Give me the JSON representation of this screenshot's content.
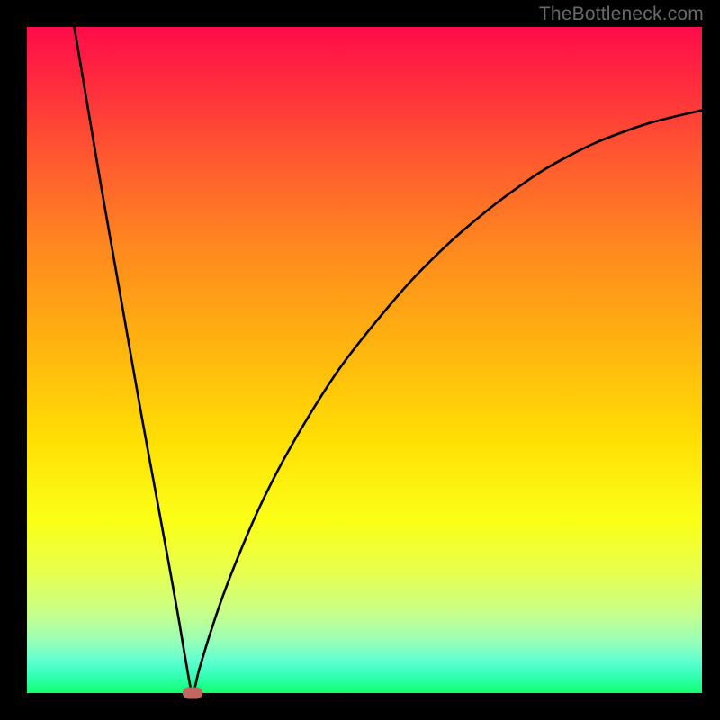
{
  "watermark": "TheBottleneck.com",
  "colors": {
    "frame": "#000000",
    "curve": "#000000",
    "marker": "#c06762"
  },
  "chart_data": {
    "type": "line",
    "title": "",
    "xlabel": "",
    "ylabel": "",
    "xlim": [
      0,
      100
    ],
    "ylim": [
      0,
      100
    ],
    "marker": {
      "x": 24.5,
      "y": 0
    },
    "curve_points": [
      {
        "x": 7.0,
        "y": 100.0
      },
      {
        "x": 9.0,
        "y": 88.0
      },
      {
        "x": 11.0,
        "y": 76.0
      },
      {
        "x": 13.0,
        "y": 64.5
      },
      {
        "x": 15.0,
        "y": 53.0
      },
      {
        "x": 17.0,
        "y": 41.5
      },
      {
        "x": 19.0,
        "y": 30.5
      },
      {
        "x": 21.0,
        "y": 19.5
      },
      {
        "x": 22.5,
        "y": 11.0
      },
      {
        "x": 23.5,
        "y": 5.0
      },
      {
        "x": 24.5,
        "y": 0.0
      },
      {
        "x": 25.5,
        "y": 3.5
      },
      {
        "x": 27.0,
        "y": 8.5
      },
      {
        "x": 29.0,
        "y": 14.5
      },
      {
        "x": 31.5,
        "y": 21.0
      },
      {
        "x": 34.5,
        "y": 28.0
      },
      {
        "x": 38.0,
        "y": 35.0
      },
      {
        "x": 42.0,
        "y": 42.0
      },
      {
        "x": 46.5,
        "y": 49.0
      },
      {
        "x": 51.5,
        "y": 55.5
      },
      {
        "x": 57.0,
        "y": 62.0
      },
      {
        "x": 63.0,
        "y": 68.0
      },
      {
        "x": 69.5,
        "y": 73.5
      },
      {
        "x": 76.5,
        "y": 78.5
      },
      {
        "x": 84.0,
        "y": 82.5
      },
      {
        "x": 92.0,
        "y": 85.5
      },
      {
        "x": 100.0,
        "y": 87.5
      }
    ]
  }
}
